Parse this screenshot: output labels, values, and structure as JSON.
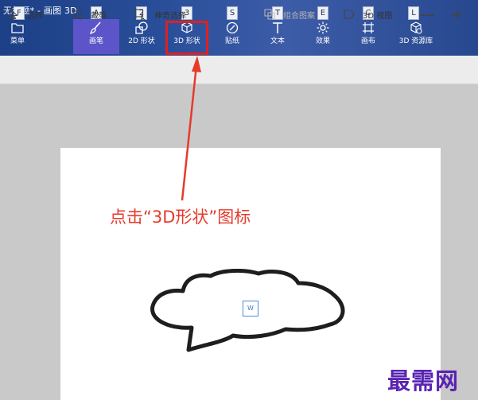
{
  "window": {
    "title": "无标题* - 画图 3D"
  },
  "ribbon": {
    "tools": [
      {
        "id": "menu",
        "label": "菜单",
        "key": "F"
      },
      {
        "id": "brushes",
        "label": "画笔",
        "key": "A"
      },
      {
        "id": "shapes2d",
        "label": "2D 形状",
        "key": "2"
      },
      {
        "id": "shapes3d",
        "label": "3D 形状",
        "key": "3"
      },
      {
        "id": "stickers",
        "label": "贴纸",
        "key": "S"
      },
      {
        "id": "text",
        "label": "文本",
        "key": "T"
      },
      {
        "id": "effects",
        "label": "效果",
        "key": "E"
      },
      {
        "id": "canvas",
        "label": "画布",
        "key": "C"
      },
      {
        "id": "library",
        "label": "3D 资源库",
        "key": "L"
      }
    ],
    "active_tool": "画笔",
    "highlighted_tool": "3D 形状"
  },
  "toolbar": {
    "select": "选择",
    "crop": "裁剪",
    "magic_select": "神奇选择",
    "group": "组合图案",
    "view3d": "3D 视图",
    "zoom_out": "—",
    "zoom_in": "+"
  },
  "annotation": {
    "text": "点击“3D形状”图标",
    "color": "#e63a2b"
  },
  "canvas": {
    "sticker_label": "W"
  },
  "watermark": {
    "text": "最需网",
    "color": "#5a23b3"
  },
  "colors": {
    "ribbon": "#2a4f9a",
    "active_tab": "#5b55c9",
    "highlight": "#e02020"
  }
}
